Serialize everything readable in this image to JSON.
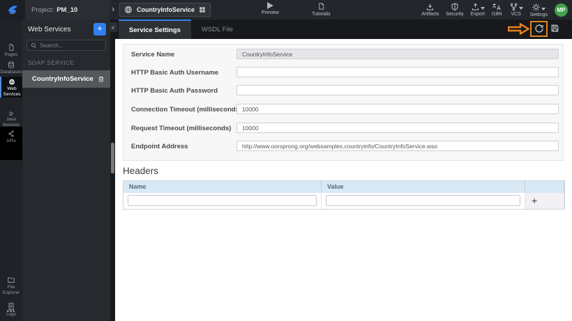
{
  "topbar": {
    "project_label": "Project:",
    "project_name": "PM_10",
    "breadcrumb_chevron": "›",
    "service_pill": "CountryInfoService",
    "preview": "Preview",
    "tutorials": "Tutorials",
    "right_items": [
      {
        "label": "Artifacts",
        "icon": "artifacts-download-icon",
        "caret": false
      },
      {
        "label": "Security",
        "icon": "security-shield-icon",
        "caret": false
      },
      {
        "label": "Export",
        "icon": "export-upload-icon",
        "caret": true
      },
      {
        "label": "I18N",
        "icon": "translate-icon",
        "caret": false
      },
      {
        "label": "VCS",
        "icon": "branch-icon",
        "caret": true
      },
      {
        "label": "Settings",
        "icon": "gear-icon",
        "caret": true
      }
    ],
    "avatar_initials": "MP"
  },
  "sidebar": {
    "items": [
      {
        "label": "Pages",
        "icon": "page-icon",
        "active": false
      },
      {
        "label": "Databases",
        "icon": "database-icon",
        "active": false
      },
      {
        "label": "Web Services",
        "icon": "globe-icon",
        "active": true
      },
      {
        "label": "Java Services",
        "icon": "coffee-icon",
        "active": false
      },
      {
        "label": "APIs",
        "icon": "api-nodes-icon",
        "active": false
      }
    ],
    "bottom_items": [
      {
        "label": "File Explorer",
        "icon": "folder-icon"
      },
      {
        "label": "Logs",
        "icon": "log-file-icon"
      }
    ],
    "more_dots": "•••"
  },
  "panel": {
    "title": "Web Services",
    "add_label": "+",
    "search_placeholder": "Search...",
    "section_label": "SOAP SERVICE",
    "items": [
      {
        "name": "CountryInfoService"
      }
    ]
  },
  "tabs": [
    {
      "label": "Service Settings",
      "active": true
    },
    {
      "label": "WSDL File",
      "active": false
    }
  ],
  "toolbar": {
    "collapse_glyph": "«"
  },
  "form": {
    "fields": [
      {
        "label": "Service Name",
        "value": "CountryInfoService",
        "disabled": true
      },
      {
        "label": "HTTP Basic Auth Username",
        "value": ""
      },
      {
        "label": "HTTP Basic Auth Password",
        "value": ""
      },
      {
        "label": "Connection Timeout (milliseconds)",
        "value": "10000"
      },
      {
        "label": "Request Timeout (milliseconds)",
        "value": "10000"
      },
      {
        "label": "Endpoint Address",
        "value": "http://www.oorsprong.org/websamples.countryinfo/CountryInfoService.wso"
      }
    ]
  },
  "headers_section": {
    "title": "Headers",
    "columns": [
      "Name",
      "Value"
    ],
    "add_label": "+",
    "rows": [
      {
        "name": "",
        "value": ""
      }
    ]
  },
  "annotation": {
    "shape": "arrow-and-box-highlight",
    "target": "reload-service-button"
  },
  "colors": {
    "accent_blue": "#2F80ED",
    "avatar_green": "#43A04C",
    "annotation_orange": "#E8821E",
    "table_header_blue": "#D9E8F5",
    "topbar_bg": "#23272C",
    "sidebar_bg": "#1F2327",
    "panel_bg": "#26292E"
  }
}
